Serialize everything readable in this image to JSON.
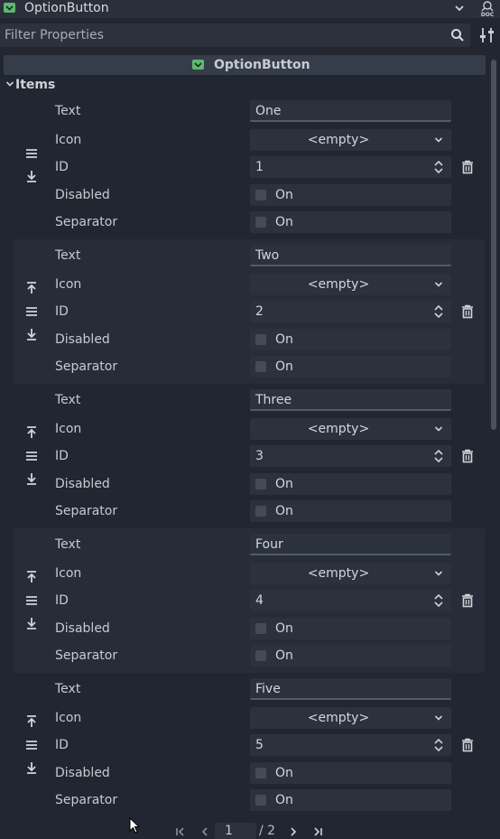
{
  "header": {
    "node_type": "OptionButton",
    "doc_icon": "doc-icon"
  },
  "filter": {
    "placeholder": "Filter Properties",
    "value": ""
  },
  "section": {
    "title": "OptionButton"
  },
  "group": {
    "title": "Items"
  },
  "property_labels": {
    "text": "Text",
    "icon": "Icon",
    "id": "ID",
    "disabled": "Disabled",
    "separator": "Separator"
  },
  "items": [
    {
      "text": "One",
      "icon": "<empty>",
      "id": "1",
      "disabled": "On",
      "separator": "On"
    },
    {
      "text": "Two",
      "icon": "<empty>",
      "id": "2",
      "disabled": "On",
      "separator": "On"
    },
    {
      "text": "Three",
      "icon": "<empty>",
      "id": "3",
      "disabled": "On",
      "separator": "On"
    },
    {
      "text": "Four",
      "icon": "<empty>",
      "id": "4",
      "disabled": "On",
      "separator": "On"
    },
    {
      "text": "Five",
      "icon": "<empty>",
      "id": "5",
      "disabled": "On",
      "separator": "On"
    }
  ],
  "pager": {
    "current": "1",
    "total": "/ 2"
  },
  "colors": {
    "background": "#212631",
    "field": "#2c323d",
    "accent_node": "#5fb870",
    "alt_row": "#272d38"
  }
}
